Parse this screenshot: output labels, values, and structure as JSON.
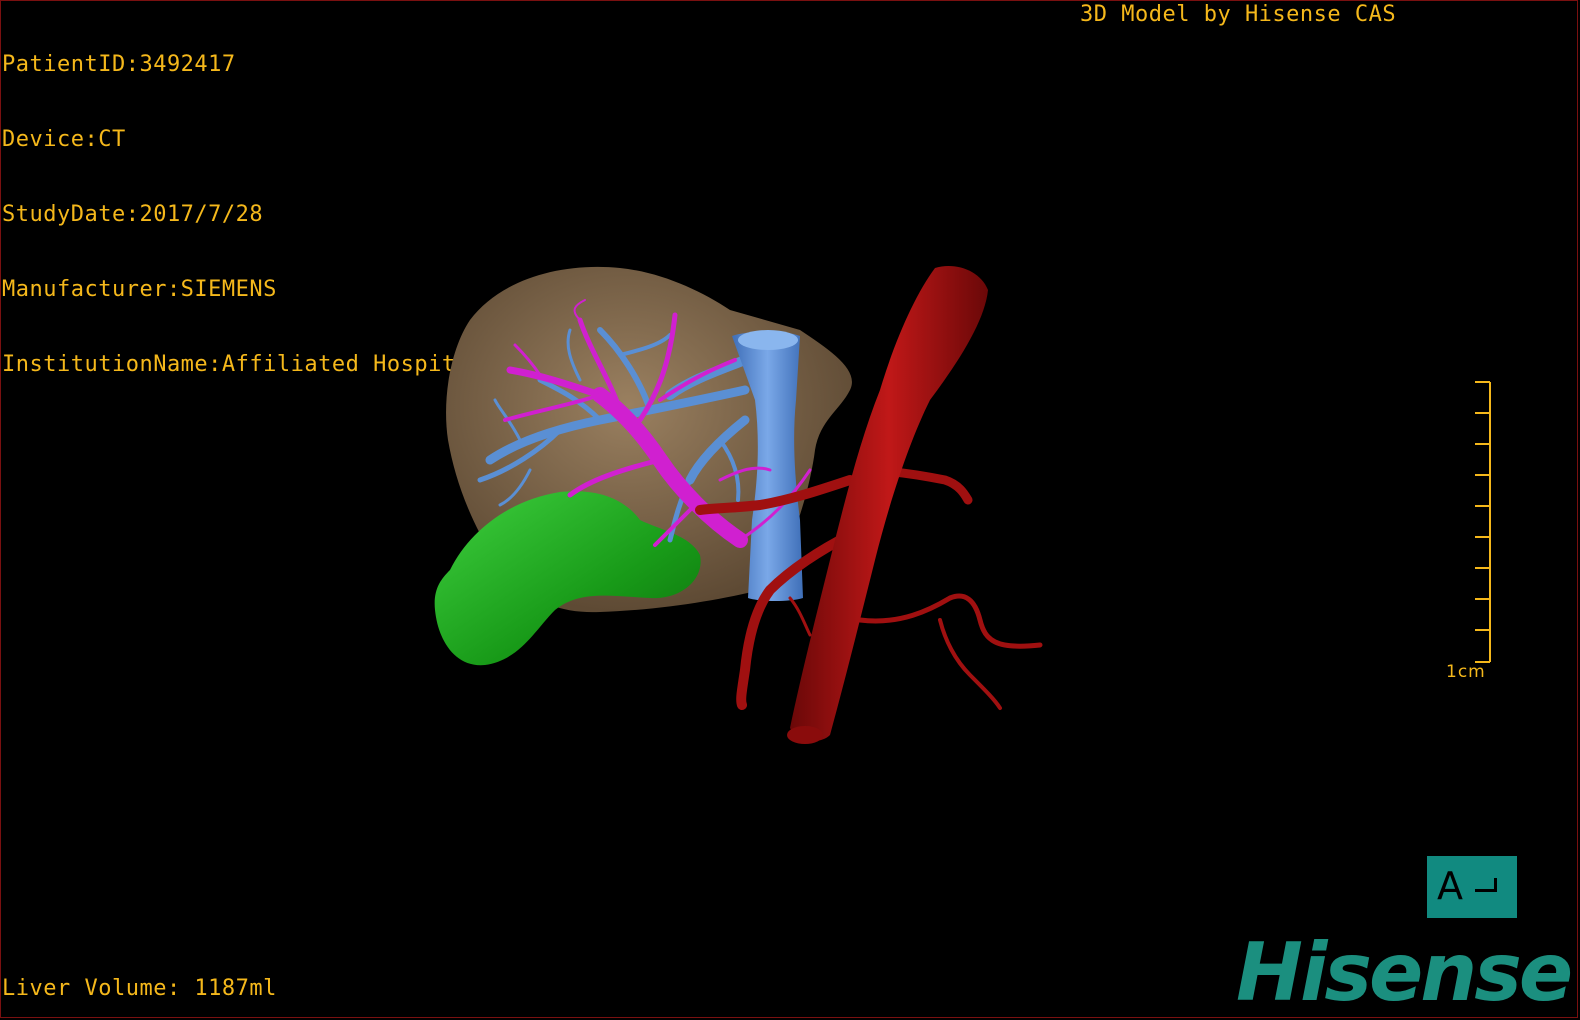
{
  "info": {
    "patient_id": "PatientID:3492417",
    "device": "Device:CT",
    "study_date": "StudyDate:2017/7/28",
    "manufacturer": "Manufacturer:SIEMENS",
    "institution": "InstitutionName:Affiliated Hospital Qingdao University-C"
  },
  "header": {
    "credit": "3D Model by Hisense CAS"
  },
  "footer": {
    "liver_volume": "Liver Volume: 1187ml"
  },
  "scale_bar": {
    "label": "1cm"
  },
  "orientation": {
    "letter": "A"
  },
  "brand": {
    "logo_text": "Hisense"
  },
  "colors": {
    "text": "#f5b81b",
    "liver": "#8b7256",
    "gallbladder": "#1fa81f",
    "portal_vein": "#d020d0",
    "hepatic_vein": "#5a8fd4",
    "artery": "#a01010",
    "brand": "#1b8f7f"
  }
}
